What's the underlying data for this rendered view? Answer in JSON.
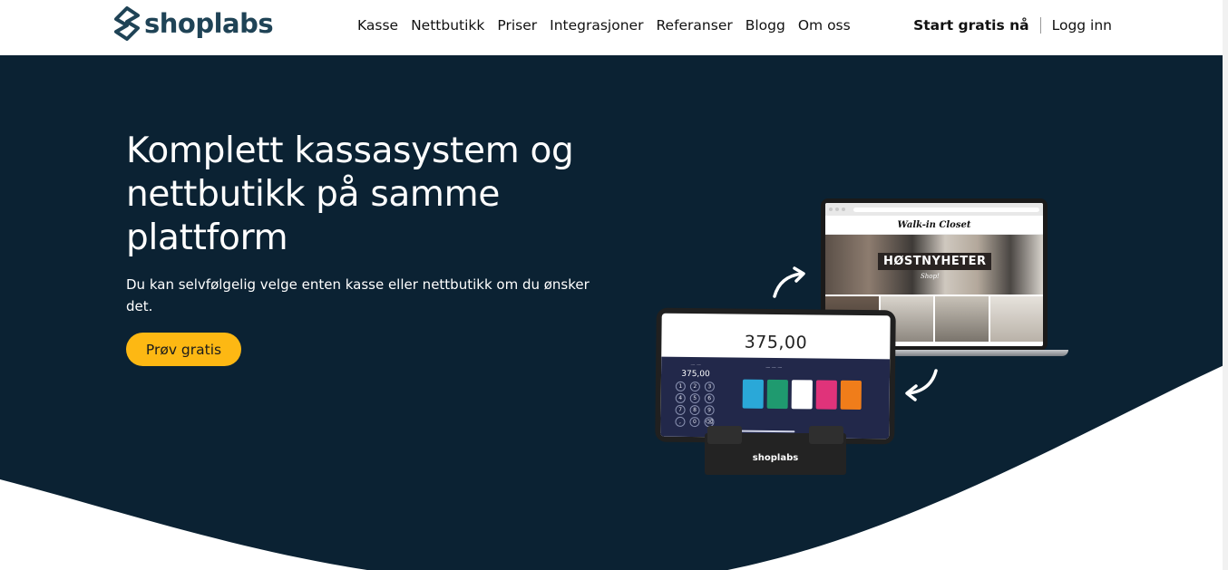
{
  "header": {
    "brand": "shoplabs",
    "nav": [
      "Kasse",
      "Nettbutikk",
      "Priser",
      "Integrasjoner",
      "Referanser",
      "Blogg",
      "Om oss"
    ],
    "start_label": "Start gratis nå",
    "login_label": "Logg inn"
  },
  "hero": {
    "headline": "Komplett kassasystem og nettbutikk på samme plattform",
    "subtext": "Du kan selvfølgelig velge enten kasse eller nettbutikk om du ønsker det.",
    "cta_label": "Prøv gratis"
  },
  "illustration": {
    "pos_amount": "375,00",
    "keypad_amount": "375,00",
    "keypad_keys": [
      "1",
      "2",
      "3",
      "4",
      "5",
      "6",
      "7",
      "8",
      "9",
      ",",
      "0",
      "⌫"
    ],
    "webshop_brand": "Walk-in Closet",
    "webshop_banner": "HØSTNYHETER",
    "webshop_banner_sub": "Shop!",
    "stand_brand": "shoplabs"
  },
  "colors": {
    "brand_dark": "#1f4356",
    "hero_bg": "#0b2233",
    "cta": "#fdb813",
    "pay_tiles": [
      "#2aa8d8",
      "#1f9a6f",
      "#ffffff",
      "#e0337a",
      "#f07d1a"
    ]
  }
}
